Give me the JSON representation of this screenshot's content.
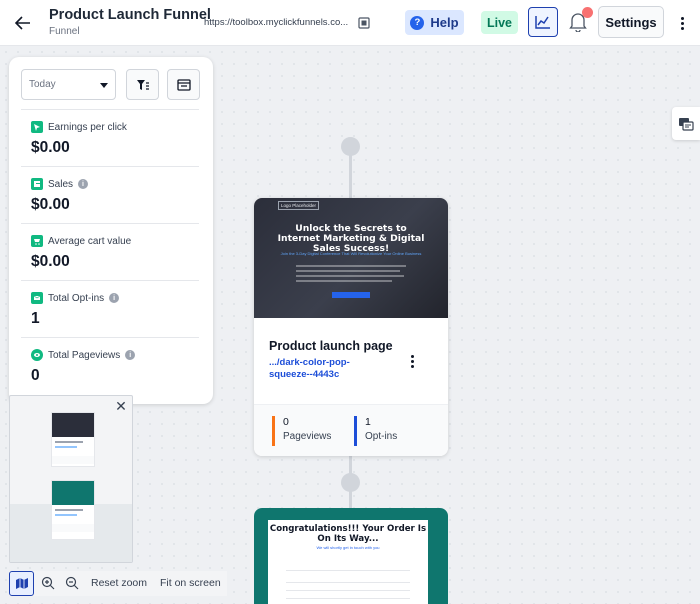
{
  "header": {
    "title": "Product Launch Funnel",
    "subtitle": "Funnel",
    "url": "https://toolbox.myclickfunnels.co...",
    "help_label": "Help",
    "live_label": "Live",
    "settings_label": "Settings"
  },
  "stats": {
    "date_range": "Today",
    "items": [
      {
        "label": "Earnings per click",
        "value": "$0.00",
        "icon": "cursor-icon"
      },
      {
        "label": "Sales",
        "value": "$0.00",
        "icon": "sales-icon"
      },
      {
        "label": "Average cart value",
        "value": "$0.00",
        "icon": "cart-icon"
      },
      {
        "label": "Total Opt-ins",
        "value": "1",
        "icon": "mail-icon"
      },
      {
        "label": "Total Pageviews",
        "value": "0",
        "icon": "eye-icon"
      }
    ]
  },
  "step": {
    "thumb_logo": "Logo Placeholder",
    "thumb_headline": "Unlock the Secrets to Internet Marketing & Digital Sales Success!",
    "thumb_subhead": "Join the 3-Day Digital Conference That Will Revolutionize Your Online Business",
    "title": "Product launch page",
    "link": ".../dark-color-pop-squeeze--4443c",
    "pageviews_value": "0",
    "pageviews_label": "Pageviews",
    "optins_value": "1",
    "optins_label": "Opt-ins"
  },
  "step2": {
    "headline": "Congratulations!!! Your Order Is On Its Way...",
    "subhead": "We will shortly get in touch with you"
  },
  "zoom": {
    "reset_label": "Reset zoom",
    "fit_label": "Fit on screen"
  },
  "colors": {
    "accent": "#1e40af",
    "live": "#047857",
    "stat_icon": "#10b981",
    "pageviews_bar": "#f97316",
    "optins_bar": "#1d4ed8"
  }
}
